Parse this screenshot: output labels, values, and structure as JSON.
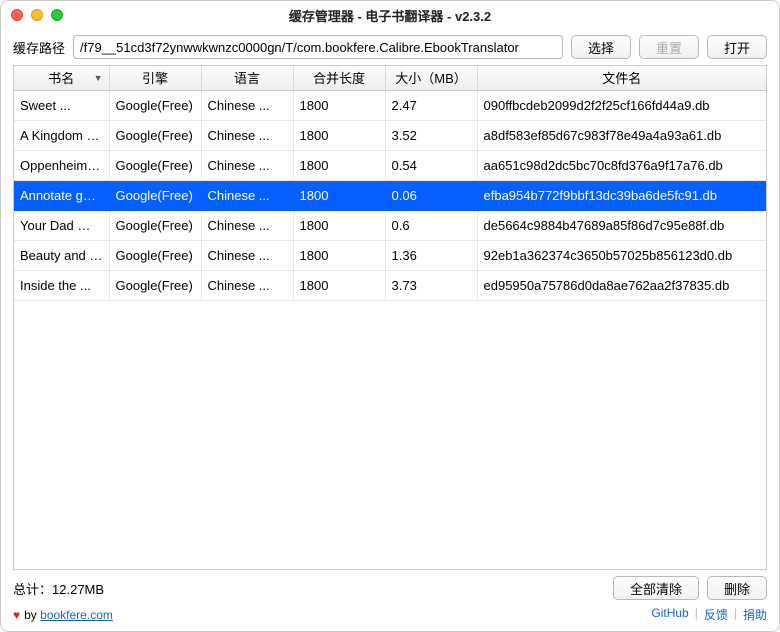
{
  "window": {
    "title": "缓存管理器 - 电子书翻译器 - v2.3.2"
  },
  "pathbar": {
    "label": "缓存路径",
    "value": "/f79__51cd3f72ynwwkwnzc0000gn/T/com.bookfere.Calibre.EbookTranslator",
    "select": "选择",
    "reset": "重置",
    "open": "打开"
  },
  "columns": {
    "book": "书名",
    "engine": "引擎",
    "lang": "语言",
    "merge": "合并长度",
    "size": "大小（MB）",
    "file": "文件名"
  },
  "rows": [
    {
      "book": "Sweet ...",
      "engine": "Google(Free)",
      "lang": "Chinese ...",
      "merge": "1800",
      "size": "2.47",
      "file": "090ffbcdeb2099d2f2f25cf166fd44a9.db",
      "selected": false
    },
    {
      "book": "A Kingdom of...",
      "engine": "Google(Free)",
      "lang": "Chinese ...",
      "merge": "1800",
      "size": "3.52",
      "file": "a8df583ef85d67c983f78e49a4a93a61.db",
      "selected": false
    },
    {
      "book": "Oppenheimer...",
      "engine": "Google(Free)",
      "lang": "Chinese ...",
      "merge": "1800",
      "size": "0.54",
      "file": "aa651c98d2dc5bc70c8fd376a9f17a76.db",
      "selected": false
    },
    {
      "book": "Annotate game",
      "engine": "Google(Free)",
      "lang": "Chinese ...",
      "merge": "1800",
      "size": "0.06",
      "file": "efba954b772f9bbf13dc39ba6de5fc91.db",
      "selected": true
    },
    {
      "book": "Your Dad Will...",
      "engine": "Google(Free)",
      "lang": "Chinese ...",
      "merge": "1800",
      "size": "0.6",
      "file": "de5664c9884b47689a85f86d7c95e88f.db",
      "selected": false
    },
    {
      "book": "Beauty and t...",
      "engine": "Google(Free)",
      "lang": "Chinese ...",
      "merge": "1800",
      "size": "1.36",
      "file": "92eb1a362374c3650b57025b856123d0.db",
      "selected": false
    },
    {
      "book": "Inside the ...",
      "engine": "Google(Free)",
      "lang": "Chinese ...",
      "merge": "1800",
      "size": "3.73",
      "file": "ed95950a75786d0da8ae762aa2f37835.db",
      "selected": false
    }
  ],
  "footer": {
    "total_label": "总计：",
    "total_value": "12.27MB",
    "clear_all": "全部清除",
    "delete": "删除"
  },
  "credits": {
    "by": "by",
    "site": "bookfere.com",
    "github": "GitHub",
    "feedback": "反馈",
    "donate": "捐助"
  }
}
